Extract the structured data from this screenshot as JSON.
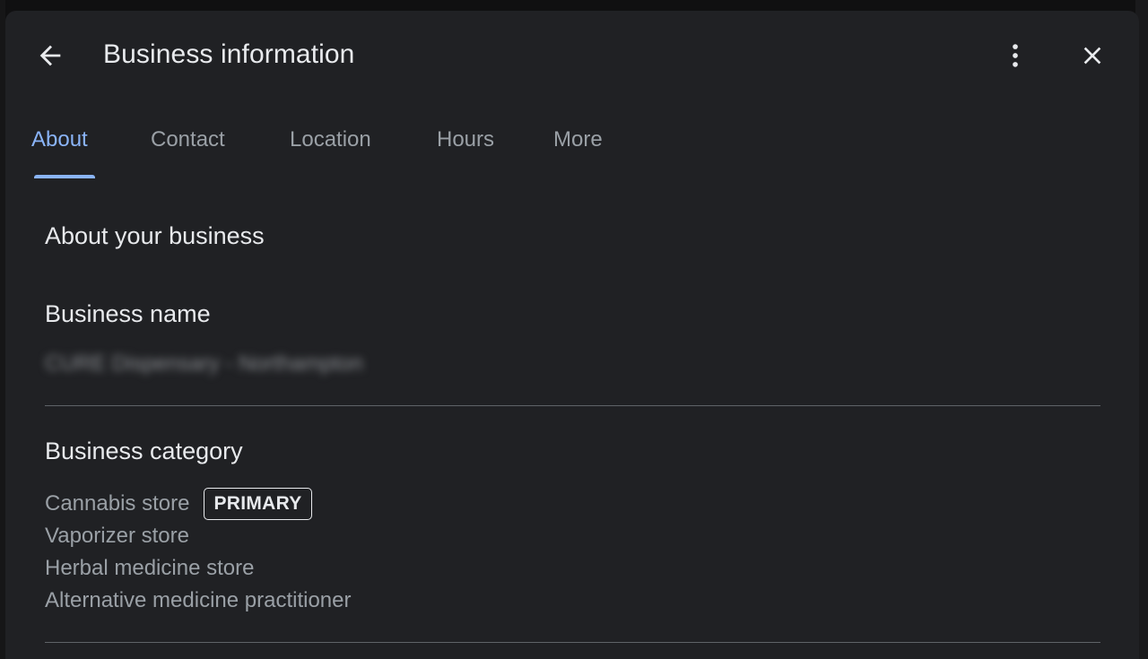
{
  "header": {
    "title": "Business information",
    "back_icon": "arrow-left-icon",
    "more_icon": "more-vert-icon",
    "close_icon": "close-icon"
  },
  "tabs": [
    {
      "label": "About",
      "active": true
    },
    {
      "label": "Contact",
      "active": false
    },
    {
      "label": "Location",
      "active": false
    },
    {
      "label": "Hours",
      "active": false
    },
    {
      "label": "More",
      "active": false
    }
  ],
  "about": {
    "section_title": "About your business",
    "business_name": {
      "label": "Business name",
      "value": "CURE Dispensary - Northampton"
    },
    "business_category": {
      "label": "Business category",
      "primary_badge": "PRIMARY",
      "categories": [
        "Cannabis store",
        "Vaporizer store",
        "Herbal medicine store",
        "Alternative medicine practitioner"
      ]
    }
  },
  "colors": {
    "surface": "#202124",
    "accent": "#8ab4f8",
    "text_primary": "#e8eaed",
    "text_secondary": "#9aa0a6",
    "divider": "#5f6368"
  }
}
